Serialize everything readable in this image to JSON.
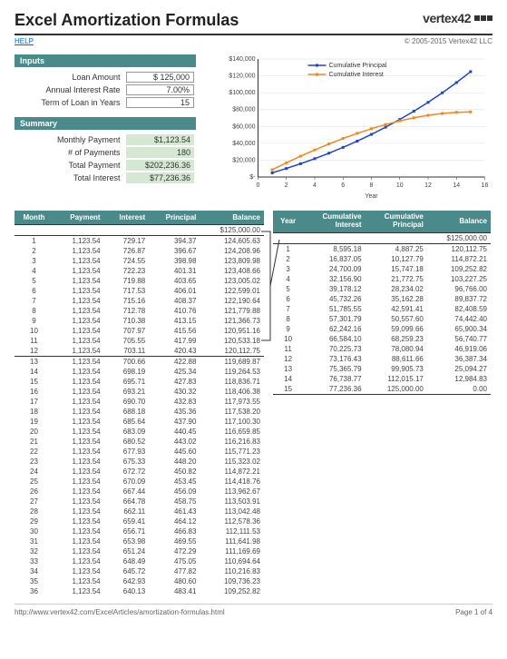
{
  "title": "Excel Amortization Formulas",
  "logo_text": "vertex42",
  "help_link": "HELP",
  "copyright": "© 2005-2015 Vertex42 LLC",
  "inputs": {
    "header": "Inputs",
    "rows": [
      {
        "label": "Loan Amount",
        "value": "$   125,000"
      },
      {
        "label": "Annual Interest Rate",
        "value": "7.00%"
      },
      {
        "label": "Term of Loan in Years",
        "value": "15"
      }
    ]
  },
  "summary": {
    "header": "Summary",
    "rows": [
      {
        "label": "Monthly Payment",
        "value": "$1,123.54"
      },
      {
        "label": "# of Payments",
        "value": "180"
      },
      {
        "label": "Total Payment",
        "value": "$202,236.36"
      },
      {
        "label": "Total Interest",
        "value": "$77,236.36"
      }
    ]
  },
  "chart_data": {
    "type": "line",
    "xlabel": "Year",
    "ylabel": "",
    "xlim": [
      0,
      16
    ],
    "ylim": [
      0,
      140000
    ],
    "yticks": [
      "$-",
      "$20,000",
      "$40,000",
      "$60,000",
      "$80,000",
      "$100,000",
      "$120,000",
      "$140,000"
    ],
    "xticks": [
      "0",
      "2",
      "4",
      "6",
      "8",
      "10",
      "12",
      "14",
      "16"
    ],
    "series": [
      {
        "name": "Cumulative Principal",
        "color": "#2244cc",
        "x": [
          1,
          2,
          3,
          4,
          5,
          6,
          7,
          8,
          9,
          10,
          11,
          12,
          13,
          14,
          15
        ],
        "y": [
          4887.25,
          10127.79,
          15747.18,
          21772.75,
          28234.02,
          35162.28,
          42591.41,
          50557.6,
          59099.66,
          68259.23,
          78080.94,
          88611.66,
          99905.73,
          112015.17,
          125000.0
        ]
      },
      {
        "name": "Cumulative Interest",
        "color": "#ee8822",
        "x": [
          1,
          2,
          3,
          4,
          5,
          6,
          7,
          8,
          9,
          10,
          11,
          12,
          13,
          14,
          15
        ],
        "y": [
          8595.18,
          16837.05,
          24700.09,
          32156.9,
          39178.12,
          45732.26,
          51785.55,
          57301.79,
          62242.16,
          66584.1,
          70225.73,
          73176.43,
          75365.79,
          76738.77,
          77236.36
        ]
      }
    ]
  },
  "month_table": {
    "headers": [
      "Month",
      "Payment",
      "Interest",
      "Principal",
      "Balance"
    ],
    "initial_balance": "$125,000.00",
    "rows": [
      [
        "1",
        "1,123.54",
        "729.17",
        "394.37",
        "124,605.63"
      ],
      [
        "2",
        "1,123.54",
        "726.87",
        "396.67",
        "124,208.96"
      ],
      [
        "3",
        "1,123.54",
        "724.55",
        "398.98",
        "123,809.98"
      ],
      [
        "4",
        "1,123.54",
        "722.23",
        "401.31",
        "123,408.66"
      ],
      [
        "5",
        "1,123.54",
        "719.88",
        "403.65",
        "123,005.02"
      ],
      [
        "6",
        "1,123.54",
        "717.53",
        "406.01",
        "122,599.01"
      ],
      [
        "7",
        "1,123.54",
        "715.16",
        "408.37",
        "122,190.64"
      ],
      [
        "8",
        "1,123.54",
        "712.78",
        "410.76",
        "121,779.88"
      ],
      [
        "9",
        "1,123.54",
        "710.38",
        "413.15",
        "121,366.73"
      ],
      [
        "10",
        "1,123.54",
        "707.97",
        "415.56",
        "120,951.16"
      ],
      [
        "11",
        "1,123.54",
        "705.55",
        "417.99",
        "120,533.18"
      ],
      [
        "12",
        "1,123.54",
        "703.11",
        "420.43",
        "120,112.75"
      ],
      [
        "13",
        "1,123.54",
        "700.66",
        "422.88",
        "119,689.87"
      ],
      [
        "14",
        "1,123.54",
        "698.19",
        "425.34",
        "119,264.53"
      ],
      [
        "15",
        "1,123.54",
        "695.71",
        "427.83",
        "118,836.71"
      ],
      [
        "16",
        "1,123.54",
        "693.21",
        "430.32",
        "118,406.38"
      ],
      [
        "17",
        "1,123.54",
        "690.70",
        "432.83",
        "117,973.55"
      ],
      [
        "18",
        "1,123.54",
        "688.18",
        "435.36",
        "117,538.20"
      ],
      [
        "19",
        "1,123.54",
        "685.64",
        "437.90",
        "117,100.30"
      ],
      [
        "20",
        "1,123.54",
        "683.09",
        "440.45",
        "116,659.85"
      ],
      [
        "21",
        "1,123.54",
        "680.52",
        "443.02",
        "116,216.83"
      ],
      [
        "22",
        "1,123.54",
        "677.93",
        "445.60",
        "115,771.23"
      ],
      [
        "23",
        "1,123.54",
        "675.33",
        "448.20",
        "115,323.02"
      ],
      [
        "24",
        "1,123.54",
        "672.72",
        "450.82",
        "114,872.21"
      ],
      [
        "25",
        "1,123.54",
        "670.09",
        "453.45",
        "114,418.76"
      ],
      [
        "26",
        "1,123.54",
        "667.44",
        "456.09",
        "113,962.67"
      ],
      [
        "27",
        "1,123.54",
        "664.78",
        "458.75",
        "113,503.91"
      ],
      [
        "28",
        "1,123.54",
        "662.11",
        "461.43",
        "113,042.48"
      ],
      [
        "29",
        "1,123.54",
        "659.41",
        "464.12",
        "112,578.36"
      ],
      [
        "30",
        "1,123.54",
        "656.71",
        "466.83",
        "112,111.53"
      ],
      [
        "31",
        "1,123.54",
        "653.98",
        "469.55",
        "111,641.98"
      ],
      [
        "32",
        "1,123.54",
        "651.24",
        "472.29",
        "111,169.69"
      ],
      [
        "33",
        "1,123.54",
        "648.49",
        "475.05",
        "110,694.64"
      ],
      [
        "34",
        "1,123.54",
        "645.72",
        "477.82",
        "110,216.83"
      ],
      [
        "35",
        "1,123.54",
        "642.93",
        "480.60",
        "109,736.23"
      ],
      [
        "36",
        "1,123.54",
        "640.13",
        "483.41",
        "109,252.82"
      ]
    ]
  },
  "year_table": {
    "headers": [
      "Year",
      "Cumulative Interest",
      "Cumulative Principal",
      "Balance"
    ],
    "initial_balance": "$125,000.00",
    "rows": [
      [
        "1",
        "8,595.18",
        "4,887.25",
        "120,112.75"
      ],
      [
        "2",
        "16,837.05",
        "10,127.79",
        "114,872.21"
      ],
      [
        "3",
        "24,700.09",
        "15,747.18",
        "109,252.82"
      ],
      [
        "4",
        "32,156.90",
        "21,772.75",
        "103,227.25"
      ],
      [
        "5",
        "39,178.12",
        "28,234.02",
        "96,766.00"
      ],
      [
        "6",
        "45,732.26",
        "35,162.28",
        "89,837.72"
      ],
      [
        "7",
        "51,785.55",
        "42,591.41",
        "82,408.59"
      ],
      [
        "8",
        "57,301.79",
        "50,557.60",
        "74,442.40"
      ],
      [
        "9",
        "62,242.16",
        "59,099.66",
        "65,900.34"
      ],
      [
        "10",
        "66,584.10",
        "68,259.23",
        "56,740.77"
      ],
      [
        "11",
        "70,225.73",
        "78,080.94",
        "46,919.06"
      ],
      [
        "12",
        "73,176.43",
        "88,611.66",
        "36,387.34"
      ],
      [
        "13",
        "75,365.79",
        "99,905.73",
        "25,094.27"
      ],
      [
        "14",
        "76,738.77",
        "112,015.17",
        "12,984.83"
      ],
      [
        "15",
        "77,236.36",
        "125,000.00",
        "0.00"
      ]
    ]
  },
  "footer": {
    "url": "http://www.vertex42.com/ExcelArticles/amortization-formulas.html",
    "page": "Page 1 of 4"
  }
}
